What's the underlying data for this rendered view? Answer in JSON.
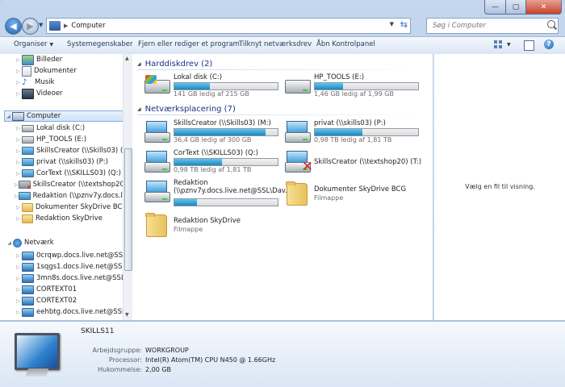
{
  "window": {
    "address": "Computer",
    "search_placeholder": "Søg i Computer",
    "caption": {
      "minimize": "—",
      "maximize": "▢",
      "close": "✕"
    }
  },
  "toolbar": {
    "organize": "Organiser",
    "system_properties": "Systemegenskaber",
    "uninstall": "Fjern eller rediger et program",
    "map_drive": "Tilknyt netværksdrev",
    "control_panel": "Åbn Kontrolpanel",
    "help": "?"
  },
  "nav": {
    "libraries": [
      "Billeder",
      "Dokumenter",
      "Musik",
      "Videoer"
    ],
    "computer_label": "Computer",
    "computer_items": [
      {
        "label": "Lokal disk (C:)",
        "icon": "drive-icon"
      },
      {
        "label": "HP_TOOLS (E:)",
        "icon": "drive-icon"
      },
      {
        "label": "SkillsCreator (\\\\Skills03) (M:)",
        "icon": "network-drive-icon"
      },
      {
        "label": "privat (\\\\skills03) (P:)",
        "icon": "network-drive-icon"
      },
      {
        "label": "CorText (\\\\SKILLS03) (Q:)",
        "icon": "network-drive-icon"
      },
      {
        "label": "SkillsCreator (\\\\textshop20) (T:)",
        "icon": "disconnected-drive-icon"
      },
      {
        "label": "Redaktion (\\\\pznv7y.docs.live.ne",
        "icon": "network-drive-icon"
      },
      {
        "label": "Dokumenter SkyDrive BCG",
        "icon": "folder-icon"
      },
      {
        "label": "Redaktion SkyDrive",
        "icon": "folder-icon"
      }
    ],
    "network_label": "Netværk",
    "network_items": [
      "0crqwp.docs.live.net@SSL",
      "1sqgs1.docs.live.net@SSL",
      "3mn8s.docs.live.net@SSL",
      "CORTEXT01",
      "CORTEXT02",
      "eehbtg.docs.live.net@SSL"
    ]
  },
  "content": {
    "group_hdd": "Harddiskdrev (2)",
    "group_net": "Netværksplacering (7)",
    "hdd": [
      {
        "name": "Lokal disk (C:)",
        "free": "141 GB ledig af 215 GB",
        "used_fraction": 0.34
      },
      {
        "name": "HP_TOOLS (E:)",
        "free": "1,46 GB ledig af 1,99 GB",
        "used_fraction": 0.27
      }
    ],
    "net": [
      {
        "name": "SkillsCreator (\\\\Skills03) (M:)",
        "free": "36,4 GB ledig af 300 GB",
        "used_fraction": 0.88,
        "kind": "drive"
      },
      {
        "name": "privat (\\\\skills03) (P:)",
        "free": "0,98 TB ledig af 1,81 TB",
        "used_fraction": 0.46,
        "kind": "drive"
      },
      {
        "name": "CorText (\\\\SKILLS03) (Q:)",
        "free": "0,98 TB ledig af 1,81 TB",
        "used_fraction": 0.46,
        "kind": "drive"
      },
      {
        "name": "SkillsCreator (\\\\textshop20) (T:)",
        "kind": "disconnected"
      },
      {
        "name": "Redaktion",
        "name2": "(\\\\pznv7y.docs.live.net@SSL\\Dav...",
        "used_fraction": 0.22,
        "kind": "drive"
      },
      {
        "name": "Dokumenter SkyDrive BCG",
        "sub": "Filmappe",
        "kind": "folder"
      },
      {
        "name": "Redaktion SkyDrive",
        "sub": "Filmappe",
        "kind": "folder"
      }
    ]
  },
  "preview": {
    "message": "Vælg en fil til visning."
  },
  "details": {
    "name": "SKILLS11",
    "workgroup_label": "Arbejdsgruppe:",
    "workgroup": "WORKGROUP",
    "processor_label": "Processor:",
    "processor": "Intel(R) Atom(TM) CPU N450   @ 1.66GHz",
    "memory_label": "Hukommelse:",
    "memory": "2,00 GB"
  }
}
